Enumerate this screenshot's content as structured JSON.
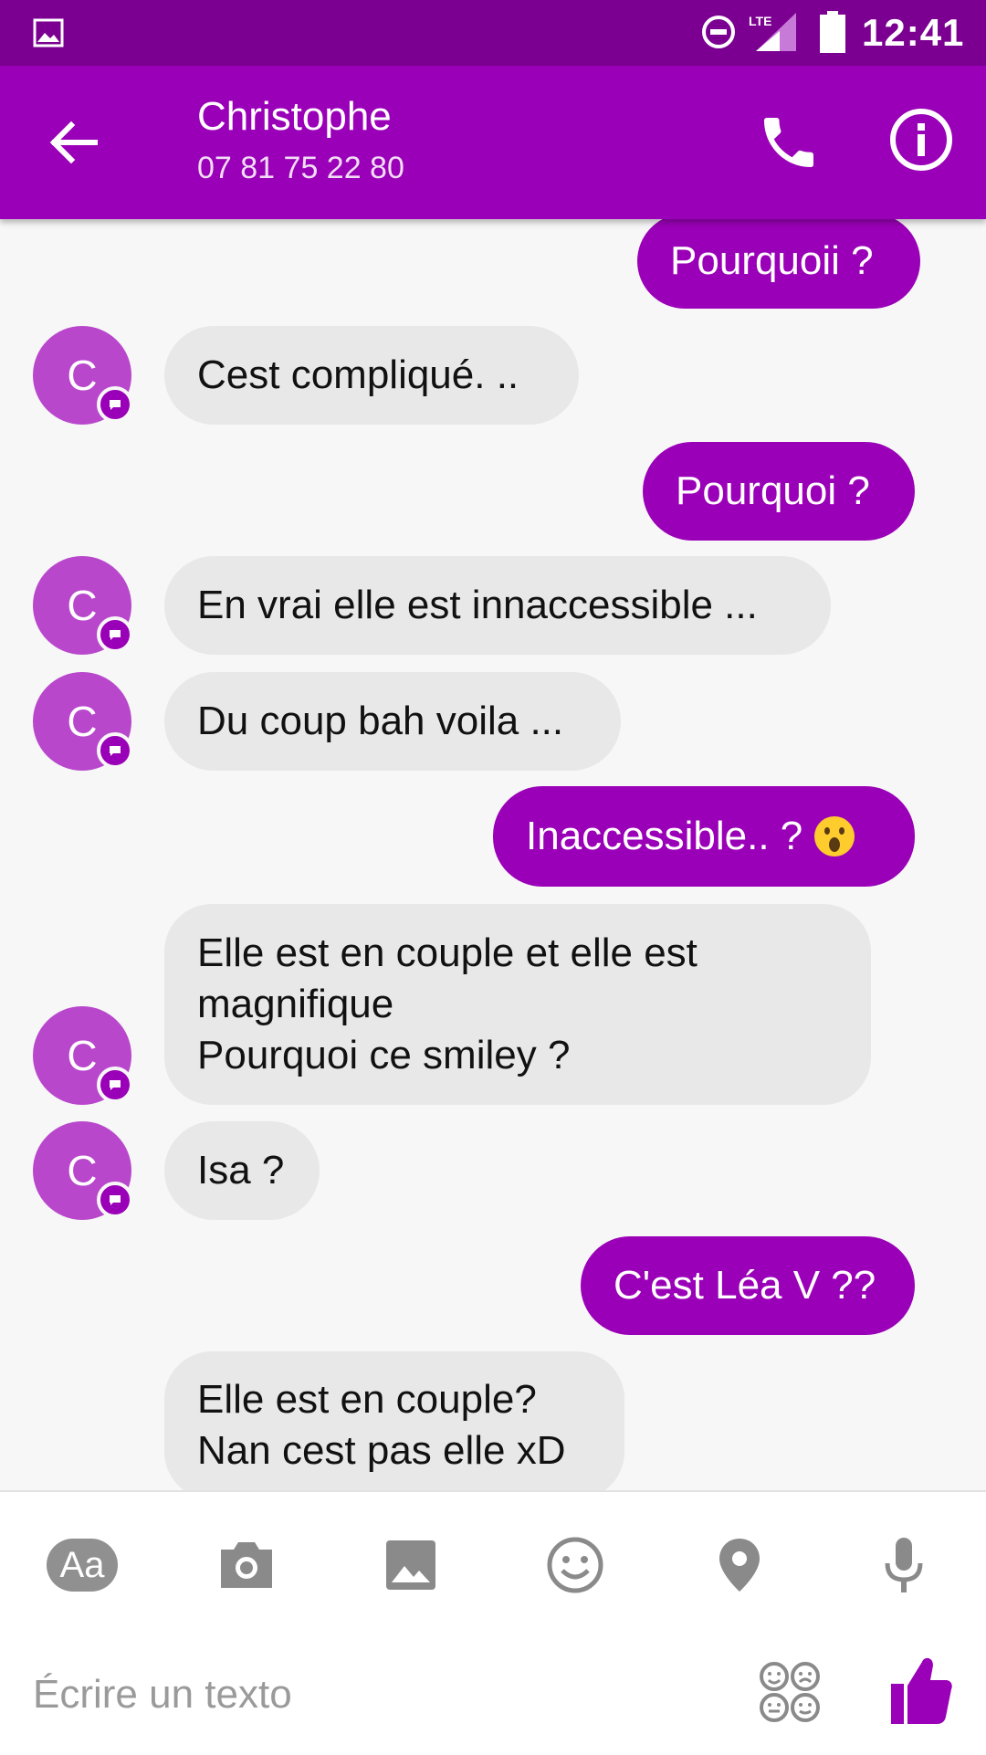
{
  "status_bar": {
    "network": "LTE",
    "time": "12:41"
  },
  "header": {
    "contact_name": "Christophe",
    "contact_phone": "07 81 75 22 80"
  },
  "messages": [
    {
      "direction": "out",
      "text": "Pourquoii ?"
    },
    {
      "direction": "in",
      "text": "Cest compliqué. .."
    },
    {
      "direction": "out",
      "text": "Pourquoi ?"
    },
    {
      "direction": "in",
      "text": "En vrai elle est innaccessible ..."
    },
    {
      "direction": "in",
      "text": "Du coup bah voila ..."
    },
    {
      "direction": "out",
      "text": "Inaccessible.. ?"
    },
    {
      "direction": "in",
      "text": "Elle est en couple et elle est\nmagnifique\nPourquoi ce smiley ?"
    },
    {
      "direction": "in",
      "text": "Isa ?"
    },
    {
      "direction": "out",
      "text": "C'est Léa V ??"
    },
    {
      "direction": "in",
      "text": "Elle est en couple?\nNan cest pas elle xD"
    }
  ],
  "avatar_letter": "C",
  "composer": {
    "text_style_label": "Aa",
    "placeholder": "Écrire un texto",
    "icons": [
      "text-format-icon",
      "camera-icon",
      "gallery-icon",
      "emoji-icon",
      "location-icon",
      "microphone-icon",
      "stickers-icon",
      "thumbs-up-icon"
    ]
  },
  "colors": {
    "status_bar": "#7b0091",
    "toolbar": "#9a00b7",
    "outgoing_bubble": "#9a00b7",
    "incoming_bubble": "#e8e8e8",
    "avatar": "#b847cc"
  }
}
